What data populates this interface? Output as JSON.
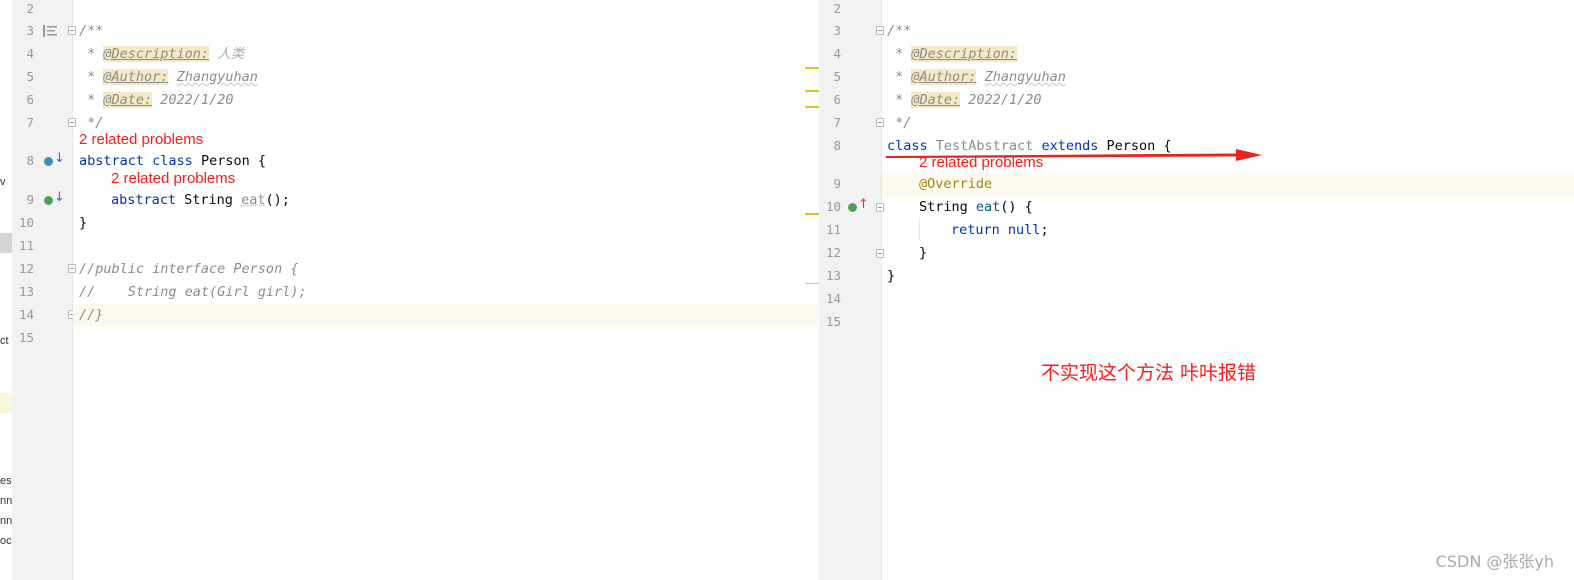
{
  "left_editor": {
    "line_numbers": [
      "2",
      "3",
      "4",
      "5",
      "6",
      "7",
      "8",
      "9",
      "10",
      "11",
      "12",
      "13",
      "14",
      "15"
    ],
    "doc_open": "/**",
    "star": " * ",
    "description_tag": "@Description:",
    "description_value": " 人类",
    "author_tag": "@Author:",
    "author_value": "Zhangyuhan",
    "date_tag": "@Date:",
    "date_value": " 2022/1/20",
    "doc_close": " */",
    "inlay_class": "2 related problems",
    "kw_abstract": "abstract",
    "kw_class": "class",
    "class_name": " Person {",
    "inlay_method": "2 related problems",
    "method_type": " String ",
    "method_name": "eat",
    "method_tail": "();",
    "close_brace": "}",
    "comment_1": "//public interface Person {",
    "comment_2": "//    String eat(Girl girl);",
    "comment_3": "//}"
  },
  "right_editor": {
    "line_numbers": [
      "2",
      "3",
      "4",
      "5",
      "6",
      "7",
      "8",
      "9",
      "10",
      "11",
      "12",
      "13",
      "14",
      "15"
    ],
    "doc_open": "/**",
    "star": " * ",
    "description_tag": "@Description:",
    "author_tag": "@Author:",
    "author_value": "Zhangyuhan",
    "date_tag": "@Date:",
    "date_value": " 2022/1/20",
    "doc_close": " */",
    "kw_class": "class",
    "class_name": "TestAbstract",
    "kw_extends": "extends",
    "super_name": " Person {",
    "inlay_class": "2 related problems",
    "override_annotation": "@Override",
    "method_type": "String ",
    "method_name": "eat",
    "method_tail": "() {",
    "kw_return": "return",
    "kw_null": "null",
    "semicolon": ";",
    "method_close": "}",
    "class_close": "}"
  },
  "outside_fragments": [
    "v",
    "ct",
    "es\\",
    "nn",
    "nn",
    "oc"
  ],
  "caption": "不实现这个方法 咔咔报错",
  "watermark": "CSDN @张张yh",
  "colors": {
    "keyword": "#0033b3",
    "comment": "#8c8c8c",
    "annotation": "#9e880d",
    "error_inlay": "#ff1a1a",
    "current_line": "#fcfaed",
    "tag_bg": "#f5eac5",
    "arrow": "#e8231b"
  },
  "icons": {
    "left_line8": "implemented-by-icon",
    "left_line9": "implemented-by-icon",
    "right_line10": "implements-method-icon"
  }
}
